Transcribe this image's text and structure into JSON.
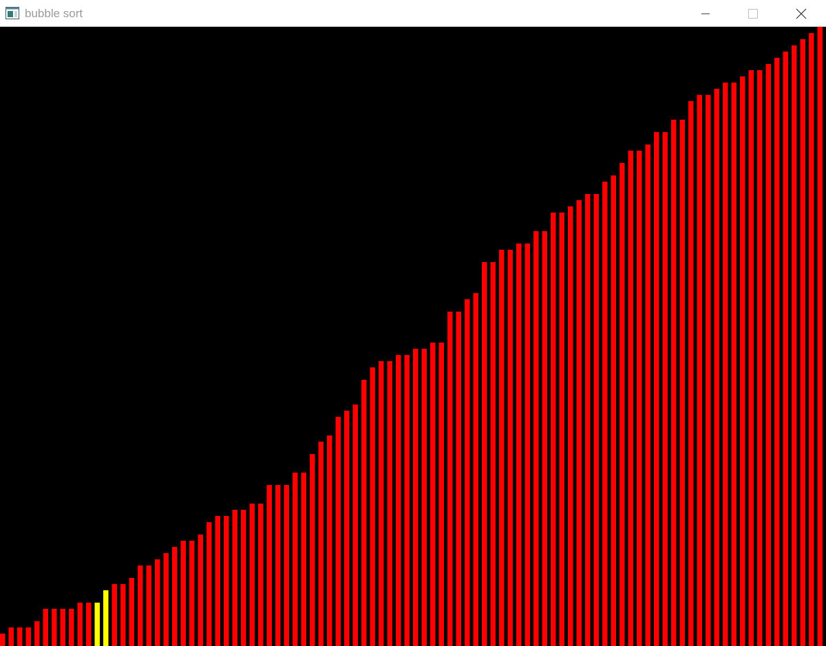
{
  "window": {
    "title": "bubble sort",
    "icons": {
      "app": "app-window-icon",
      "minimize": "minimize-icon",
      "maximize": "maximize-icon",
      "close": "close-icon"
    }
  },
  "colors": {
    "background": "#000000",
    "bar": "#ff0000",
    "highlight": "#ffff00",
    "titlebar": "#ffffff",
    "title_text": "#9a9a9a"
  },
  "chart_data": {
    "type": "bar",
    "ylim": [
      0,
      900
    ],
    "values": [
      18,
      27,
      27,
      27,
      36,
      54,
      54,
      54,
      54,
      63,
      63,
      63,
      81,
      90,
      90,
      99,
      117,
      117,
      126,
      135,
      144,
      153,
      153,
      162,
      180,
      189,
      189,
      198,
      198,
      207,
      207,
      234,
      234,
      234,
      252,
      252,
      279,
      297,
      306,
      333,
      342,
      351,
      387,
      405,
      414,
      414,
      423,
      423,
      432,
      432,
      441,
      441,
      486,
      486,
      504,
      513,
      558,
      558,
      576,
      576,
      585,
      585,
      603,
      603,
      630,
      630,
      639,
      648,
      657,
      657,
      675,
      684,
      702,
      720,
      720,
      729,
      747,
      747,
      765,
      765,
      792,
      801,
      801,
      810,
      819,
      819,
      828,
      837,
      837,
      846,
      855,
      864,
      873,
      882,
      891,
      900
    ],
    "highlighted_indices": [
      11,
      12
    ]
  }
}
